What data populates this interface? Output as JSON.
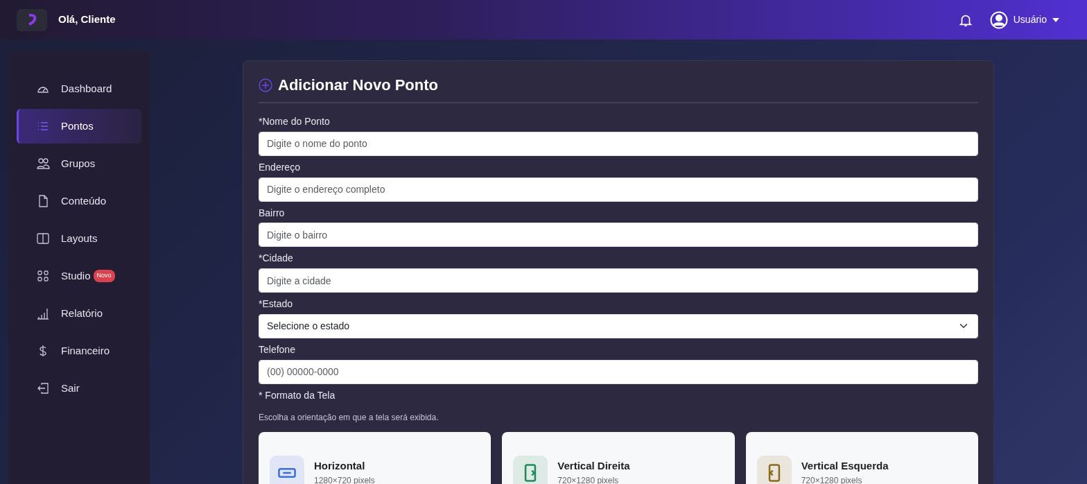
{
  "header": {
    "greeting": "Olá, Cliente",
    "user": "Usuário"
  },
  "sidebar": {
    "items": [
      {
        "label": "Dashboard",
        "kind": "gauge",
        "selected": false
      },
      {
        "label": "Pontos",
        "kind": "list",
        "selected": true
      },
      {
        "label": "Grupos",
        "kind": "people",
        "selected": false
      },
      {
        "label": "Conteúdo",
        "kind": "file",
        "selected": false
      },
      {
        "label": "Layouts",
        "kind": "columns",
        "selected": false
      },
      {
        "label": "Studio",
        "kind": "grid",
        "selected": false,
        "badge": "Novo"
      },
      {
        "label": "Relatório",
        "kind": "bars",
        "selected": false
      },
      {
        "label": "Financeiro",
        "kind": "dollar",
        "selected": false
      },
      {
        "label": "Sair",
        "kind": "exit",
        "selected": false
      }
    ]
  },
  "form": {
    "title": "Adicionar Novo Ponto",
    "fields": [
      {
        "label": "*Nome do Ponto",
        "kind": "input",
        "placeholder": "Digite o nome do ponto"
      },
      {
        "label": "Endereço",
        "kind": "input",
        "placeholder": "Digite o endereço completo"
      },
      {
        "label": "Bairro",
        "kind": "input",
        "placeholder": "Digite o bairro"
      },
      {
        "label": "*Cidade",
        "kind": "input",
        "placeholder": "Digite a cidade"
      },
      {
        "label": "*Estado",
        "kind": "select",
        "value": "Selecione o estado"
      },
      {
        "label": "Telefone",
        "kind": "input",
        "placeholder": "(00) 00000-0000"
      }
    ],
    "format": {
      "label": "* Formato da Tela",
      "hint": "Escolha a orientação em que a tela será exibida.",
      "options": [
        {
          "title": "Horizontal",
          "resolution": "1280×720 pixels",
          "kind": "horizontal",
          "color": "#3b6fd9"
        },
        {
          "title": "Vertical Direita",
          "resolution": "720×1280 pixels",
          "kind": "right",
          "color": "#1f8a5b"
        },
        {
          "title": "Vertical Esquerda",
          "resolution": "720×1280 pixels",
          "kind": "left",
          "color": "#8a6a1c"
        }
      ]
    }
  }
}
